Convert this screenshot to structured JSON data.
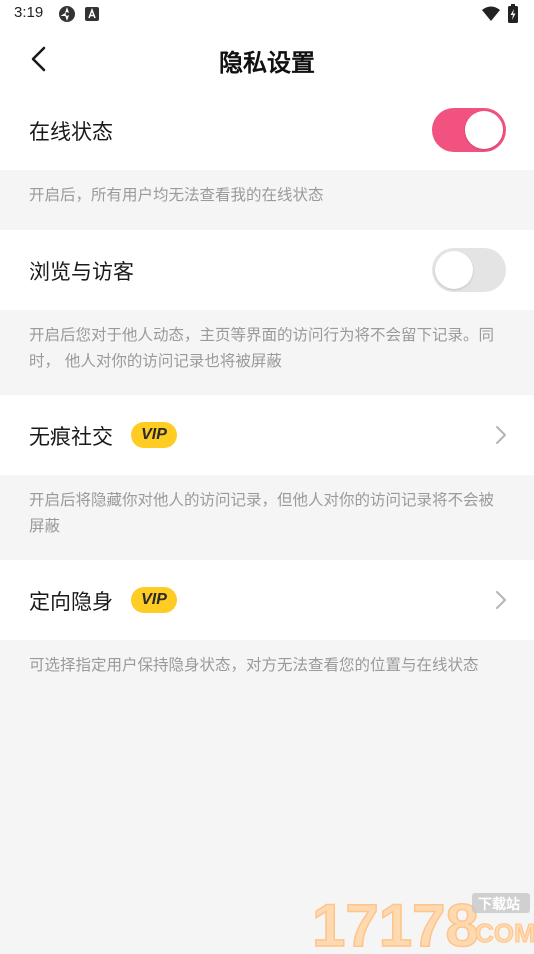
{
  "status_bar": {
    "time": "3:19"
  },
  "header": {
    "title": "隐私设置"
  },
  "settings": [
    {
      "label": "在线状态",
      "control": "toggle",
      "enabled": true,
      "description": "开启后，所有用户均无法查看我的在线状态"
    },
    {
      "label": "浏览与访客",
      "control": "toggle",
      "enabled": false,
      "description": "开启后您对于他人动态，主页等界面的访问行为将不会留下记录。同时， 他人对你的访问记录也将被屏蔽"
    },
    {
      "label": "无痕社交",
      "badge": "VIP",
      "control": "chevron",
      "description": "开启后将隐藏你对他人的访问记录，但他人对你的访问记录将不会被屏蔽"
    },
    {
      "label": "定向隐身",
      "badge": "VIP",
      "control": "chevron",
      "description": "可选择指定用户保持隐身状态，对方无法查看您的位置与在线状态"
    }
  ],
  "watermark": {
    "number": "17178",
    "tag": "下载站",
    "domain": "COM"
  },
  "colors": {
    "toggle_on": "#f2527f",
    "toggle_off": "#e4e4e4",
    "vip_badge": "#ffcc24",
    "page_background": "#f5f5f5",
    "description_text": "#9a9a9a"
  }
}
